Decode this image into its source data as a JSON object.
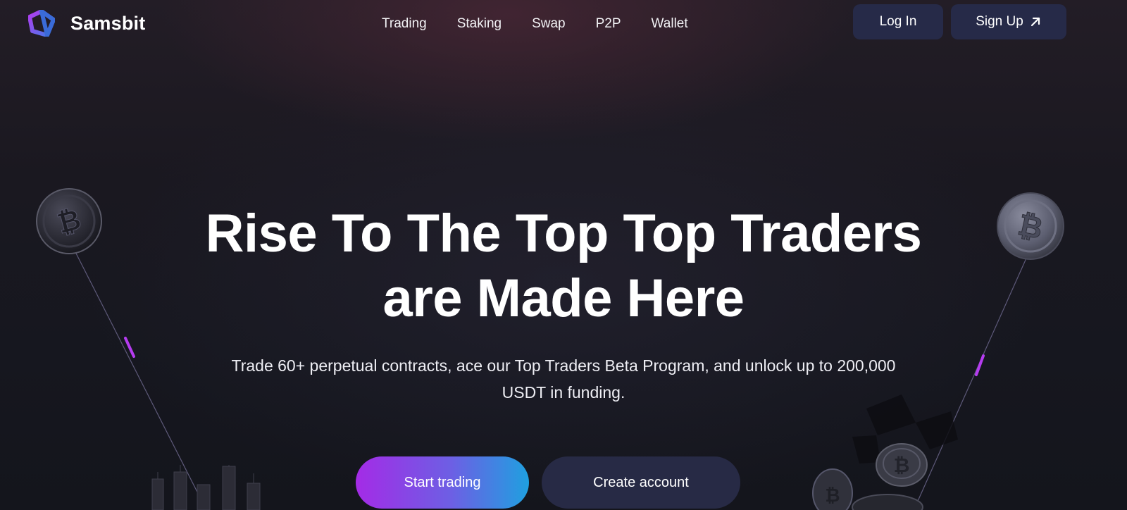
{
  "brand": {
    "name": "Samsbit"
  },
  "nav": {
    "items": [
      {
        "label": "Trading"
      },
      {
        "label": "Staking"
      },
      {
        "label": "Swap"
      },
      {
        "label": "P2P"
      },
      {
        "label": "Wallet"
      }
    ]
  },
  "auth": {
    "login_label": "Log In",
    "signup_label": "Sign Up",
    "signup_icon": "arrow-up-right-icon"
  },
  "hero": {
    "title_line1": "Rise To The Top Top Traders",
    "title_line2": "are Made Here",
    "subtitle": "Trade 60+ perpetual contracts, ace our Top Traders Beta Program, and unlock up to 200,000 USDT in funding.",
    "cta_primary": "Start trading",
    "cta_secondary": "Create account"
  },
  "colors": {
    "background": "#16171f",
    "button_dark": "#262a48",
    "gradient_start": "#a42be6",
    "gradient_end": "#1fa0e0",
    "accent_purple": "#b53cf0"
  },
  "decorations": {
    "left_coin_icon": "bitcoin-coin-icon",
    "right_coin_icon": "bitcoin-coin-icon"
  }
}
